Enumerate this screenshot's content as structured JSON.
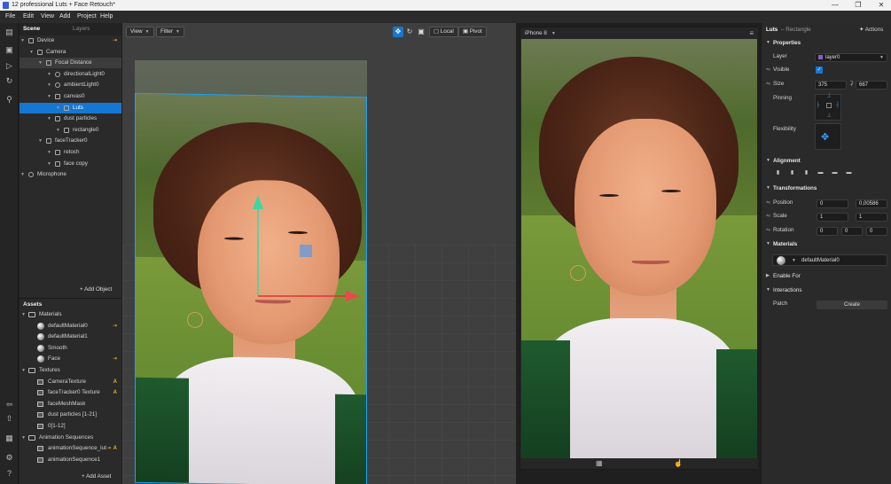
{
  "window": {
    "title": "12 professional Luts + Face Retouch*",
    "controls": [
      "—",
      "❐",
      "✕"
    ]
  },
  "menu": [
    "File",
    "Edit",
    "View",
    "Add",
    "Project",
    "Help"
  ],
  "scene_panel": {
    "tabs": [
      "Scene",
      "Layers"
    ],
    "tree": [
      {
        "label": "Device",
        "indent": 0,
        "icon": "device-icon",
        "pin": true
      },
      {
        "label": "Camera",
        "indent": 1,
        "icon": "camera-icon"
      },
      {
        "label": "Focal Distance",
        "indent": 2,
        "icon": "focal-icon",
        "state": "highlight"
      },
      {
        "label": "directionalLight0",
        "indent": 3,
        "icon": "light-icon"
      },
      {
        "label": "ambientLight0",
        "indent": 3,
        "icon": "light-icon"
      },
      {
        "label": "canvas0",
        "indent": 3,
        "icon": "canvas-icon"
      },
      {
        "label": "Luts",
        "indent": 4,
        "icon": "rectangle-icon",
        "state": "selected"
      },
      {
        "label": "dust particles",
        "indent": 3,
        "icon": "canvas-icon"
      },
      {
        "label": "rectangle0",
        "indent": 4,
        "icon": "rectangle-icon"
      },
      {
        "label": "faceTracker0",
        "indent": 2,
        "icon": "tracker-icon"
      },
      {
        "label": "retoch",
        "indent": 3,
        "icon": "mesh-icon"
      },
      {
        "label": "face copy",
        "indent": 3,
        "icon": "mesh-icon"
      },
      {
        "label": "Microphone",
        "indent": 0,
        "icon": "microphone-icon"
      }
    ],
    "add_object": "+ Add Object"
  },
  "assets_panel": {
    "title": "Assets",
    "items": [
      {
        "label": "Materials",
        "kind": "folder",
        "indent": 0
      },
      {
        "label": "defaultMaterial0",
        "kind": "material",
        "indent": 1,
        "pin": true
      },
      {
        "label": "defaultMaterial1",
        "kind": "material",
        "indent": 1
      },
      {
        "label": "Smooth",
        "kind": "material",
        "indent": 1
      },
      {
        "label": "Face",
        "kind": "material",
        "indent": 1,
        "pin": true
      },
      {
        "label": "Textures",
        "kind": "folder",
        "indent": 0
      },
      {
        "label": "CameraTexture",
        "kind": "texture",
        "indent": 1,
        "badge": "A"
      },
      {
        "label": "faceTracker0 Texture",
        "kind": "texture",
        "indent": 1,
        "badge": "A"
      },
      {
        "label": "faceMeshMask",
        "kind": "texture",
        "indent": 1
      },
      {
        "label": "dust particles [1-21]",
        "kind": "texture",
        "indent": 1
      },
      {
        "label": "0[1-12]",
        "kind": "texture",
        "indent": 1
      },
      {
        "label": "Animation Sequences",
        "kind": "folder",
        "indent": 0
      },
      {
        "label": "animationSequence_lut",
        "kind": "texture",
        "indent": 1,
        "pin": true,
        "badge": "A"
      },
      {
        "label": "animationSequence1",
        "kind": "texture",
        "indent": 1
      }
    ],
    "add_asset": "+ Add Asset"
  },
  "viewport": {
    "view_label": "View",
    "filter_label": "Filter",
    "local_label": "Local",
    "pivot_label": "Pivot"
  },
  "preview": {
    "device": "iPhone 8"
  },
  "inspector": {
    "object_name": "Luts",
    "object_type": "– Rectangle",
    "actions": "Actions",
    "properties": "Properties",
    "layer_label": "Layer",
    "layer_value": "layer0",
    "visible_label": "Visible",
    "size_label": "Size",
    "size_w": "375",
    "size_h": "667",
    "pinning_label": "Pinning",
    "flexibility_label": "Flexibility",
    "alignment": "Alignment",
    "transformations": "Transformations",
    "position_label": "Position",
    "position": [
      "0",
      "0,00586"
    ],
    "scale_label": "Scale",
    "scale": [
      "1",
      "1"
    ],
    "rotation_label": "Rotation",
    "rotation": [
      "0",
      "0",
      "0"
    ],
    "materials": "Materials",
    "material_value": "defaultMaterial0",
    "enable_for": "Enable For",
    "interactions": "Interactions",
    "patch_label": "Patch",
    "create_label": "Create"
  },
  "colors": {
    "accent": "#1677d2",
    "pin": "#e5b21d",
    "layer_swatch": "#8a5cc7"
  }
}
